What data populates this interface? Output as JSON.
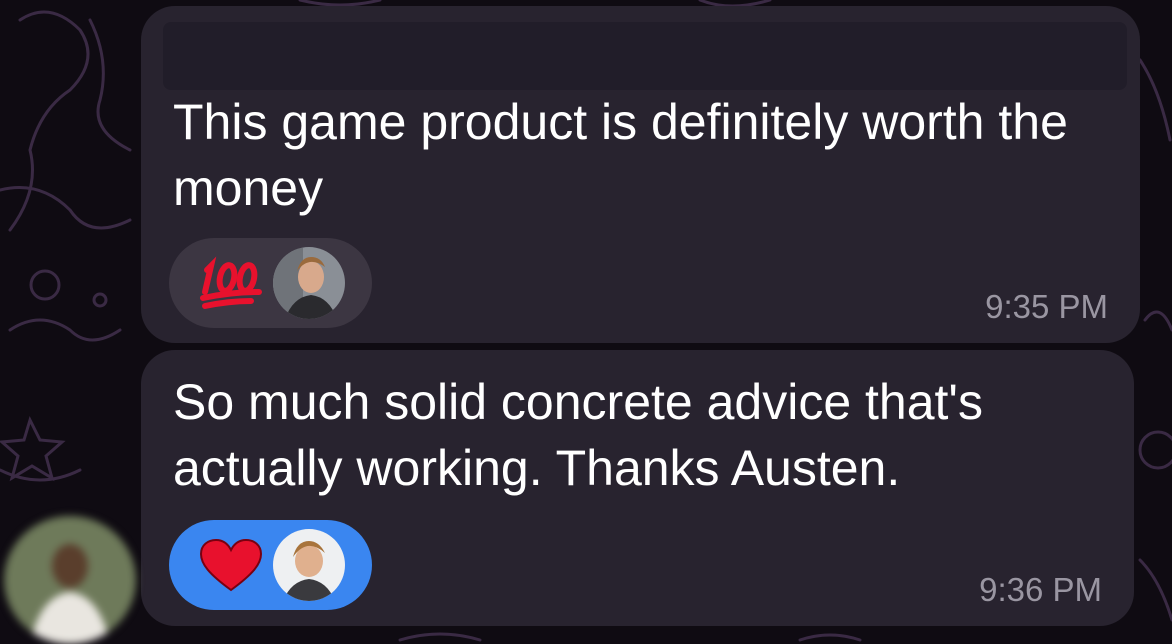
{
  "messages": [
    {
      "text": "This game product is definitely worth the money",
      "reaction": {
        "emoji_name": "hundred-points-icon",
        "avatar": "reactor-avatar"
      },
      "time": "9:35 PM"
    },
    {
      "text": "So much solid concrete advice that's actually working. Thanks Austen.",
      "reaction": {
        "emoji_name": "red-heart-icon",
        "avatar": "reactor-avatar"
      },
      "time": "9:36 PM"
    }
  ],
  "colors": {
    "background": "#0f0b12",
    "bubble": "#28232f",
    "reaction_default": "#3c3642",
    "reaction_selected": "#3a86f0",
    "timestamp": "#9a96a2",
    "hundred_red": "#e8112d"
  }
}
